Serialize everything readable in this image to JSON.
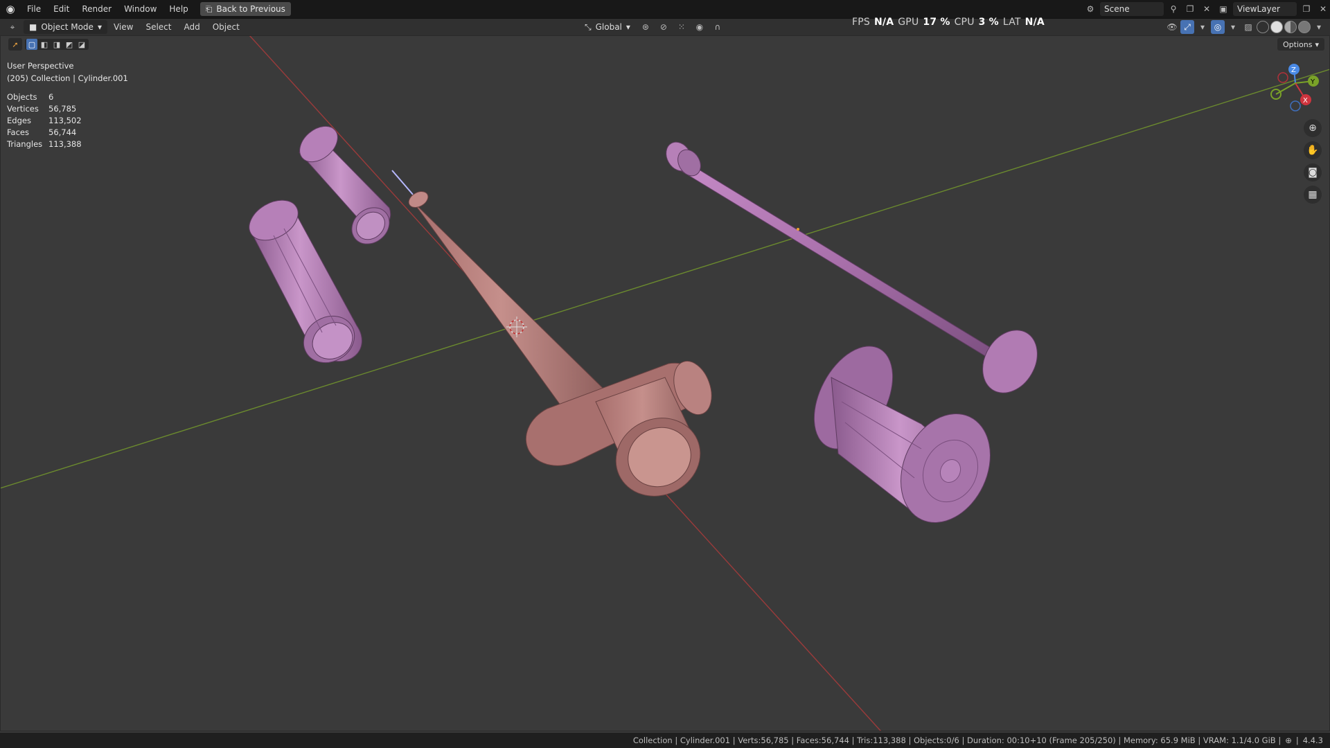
{
  "topbar": {
    "menu": [
      "File",
      "Edit",
      "Render",
      "Window",
      "Help"
    ],
    "back_button": "Back to Previous",
    "scene": "Scene",
    "view_layer": "ViewLayer"
  },
  "header": {
    "mode": "Object Mode",
    "menus": [
      "View",
      "Select",
      "Add",
      "Object"
    ],
    "orientation": "Global",
    "options": "Options"
  },
  "perf": {
    "fps_label": "FPS",
    "fps_value": "N/A",
    "gpu_label": "GPU",
    "gpu_value": "17 %",
    "cpu_label": "CPU",
    "cpu_value": "3 %",
    "lat_label": "LAT",
    "lat_value": "N/A"
  },
  "overlay": {
    "perspective": "User Perspective",
    "collection": "(205) Collection | Cylinder.001"
  },
  "stats": [
    {
      "label": "Objects",
      "value": "6"
    },
    {
      "label": "Vertices",
      "value": "56,785"
    },
    {
      "label": "Edges",
      "value": "113,502"
    },
    {
      "label": "Faces",
      "value": "56,744"
    },
    {
      "label": "Triangles",
      "value": "113,388"
    }
  ],
  "gizmo": {
    "x": "X",
    "y": "Y",
    "z": "Z"
  },
  "icons": {
    "logo": "blender-logo-icon",
    "zoom": "zoom-icon",
    "pan": "hand-pan-icon",
    "camera": "camera-view-icon",
    "grid": "ortho-grid-icon"
  },
  "statusbar": "Collection | Cylinder.001 | Verts:56,785 | Faces:56,744 | Tris:113,388 | Objects:0/6 | Duration: 00:10+10 (Frame 205/250) | Memory: 65.9 MiB | VRAM: 1.1/4.0 GiB |",
  "version": "4.4.3"
}
